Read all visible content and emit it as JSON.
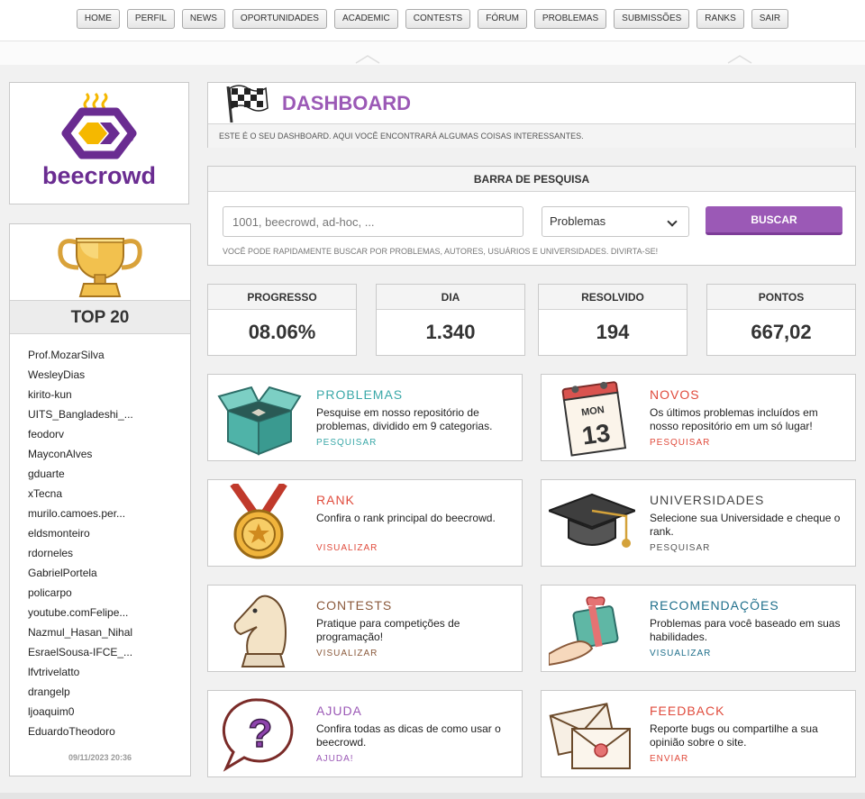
{
  "nav": [
    "HOME",
    "PERFIL",
    "NEWS",
    "OPORTUNIDADES",
    "ACADEMIC",
    "CONTESTS",
    "FÓRUM",
    "PROBLEMAS",
    "SUBMISSÕES",
    "RANKS",
    "SAIR"
  ],
  "logo": {
    "text": "beecrowd",
    "color": "#6a2c91",
    "accent": "#f5b800"
  },
  "top20": {
    "title": "TOP 20",
    "users": [
      "Prof.MozarSilva",
      "WesleyDias",
      "kirito-kun",
      "UITS_Bangladeshi_...",
      "feodorv",
      "MayconAlves",
      "gduarte",
      "xTecna",
      "murilo.camoes.per...",
      "eldsmonteiro",
      "rdorneles",
      "GabrielPortela",
      "policarpo",
      "youtube.comFelipe...",
      "Nazmul_Hasan_Nihal",
      "EsraelSousa-IFCE_...",
      "lfvtrivelatto",
      "drangelp",
      "ljoaquim0",
      "EduardoTheodoro"
    ],
    "date": "09/11/2023 20:36"
  },
  "dashboard": {
    "title": "DASHBOARD",
    "description": "ESTE É O SEU DASHBOARD. AQUI VOCÊ ENCONTRARÁ ALGUMAS COISAS INTERESSANTES."
  },
  "search": {
    "title": "BARRA DE PESQUISA",
    "placeholder": "1001, beecrowd, ad-hoc, ...",
    "select_value": "Problemas",
    "button": "BUSCAR",
    "hint": "VOCÊ PODE RAPIDAMENTE BUSCAR POR PROBLEMAS, AUTORES, USUÁRIOS E UNIVERSIDADES. DIVIRTA-SE!"
  },
  "stats": [
    {
      "label": "PROGRESSO",
      "value": "08.06%"
    },
    {
      "label": "DIA",
      "value": "1.340"
    },
    {
      "label": "RESOLVIDO",
      "value": "194"
    },
    {
      "label": "PONTOS",
      "value": "667,02"
    }
  ],
  "cards": [
    {
      "title": "PROBLEMAS",
      "desc": "Pesquise em nosso repositório de problemas, dividido em 9 categorias.",
      "link": "PESQUISAR",
      "color": "#3aa8a8",
      "icon": "box-icon"
    },
    {
      "title": "NOVOS",
      "desc": "Os últimos problemas incluídos em nosso repositório em um só lugar!",
      "link": "PESQUISAR",
      "color": "#e04b3c",
      "icon": "calendar-icon",
      "calendar": {
        "day": "MON",
        "date": "13"
      }
    },
    {
      "title": "RANK",
      "desc": "Confira o rank principal do beecrowd.",
      "link": "VISUALIZAR",
      "color": "#e04b3c",
      "icon": "medal-icon"
    },
    {
      "title": "UNIVERSIDADES",
      "desc": "Selecione sua Universidade e cheque o rank.",
      "link": "PESQUISAR",
      "color": "#444444",
      "icon": "graduation-cap-icon"
    },
    {
      "title": "CONTESTS",
      "desc": "Pratique para competições de programação!",
      "link": "VISUALIZAR",
      "color": "#8b5a3c",
      "icon": "chess-knight-icon"
    },
    {
      "title": "RECOMENDAÇÕES",
      "desc": "Problemas para você baseado em suas habilidades.",
      "link": "VISUALIZAR",
      "color": "#1f6f8b",
      "icon": "gift-icon"
    },
    {
      "title": "AJUDA",
      "desc": "Confira todas as dicas de como usar o beecrowd.",
      "link": "AJUDA!",
      "color": "#9b59b6",
      "icon": "question-bubble-icon"
    },
    {
      "title": "FEEDBACK",
      "desc": "Reporte bugs ou compartilhe a sua opinião sobre o site.",
      "link": "ENVIAR",
      "color": "#e04b3c",
      "icon": "envelope-icon"
    }
  ]
}
